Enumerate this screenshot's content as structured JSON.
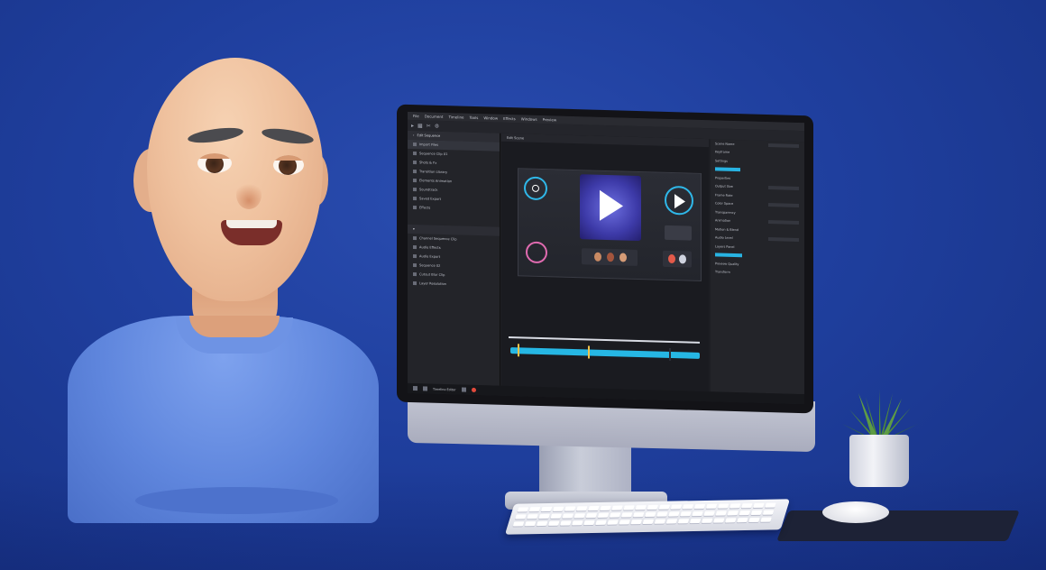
{
  "scene": {
    "background": "#1f3f9e",
    "shirt_color": "#6a8fe4",
    "skin_color": "#efc19e"
  },
  "monitor_ui": {
    "accent": "#28b3e2",
    "menu": [
      "File",
      "Document",
      "Timeline",
      "Tools",
      "Window",
      "Effects",
      "Windows",
      "Preview"
    ],
    "center_tab": "Edit Scene",
    "left_panel_title": "Edit Sequence",
    "left_rows": [
      "Import Files",
      "Sequence Clip 01",
      "Shots & Fx",
      "Transition Library",
      "Elements Animation",
      "Soundtrack",
      "Saved Export",
      "Effects"
    ],
    "left_rows_lower": [
      "Channel Sequence Clip",
      "Audio Effects",
      "Audio Export",
      "Sequence 02",
      "Cutout Blur Clip",
      "Layer Resolution"
    ],
    "right_rows": [
      "Scene Name",
      "Keyframe",
      "Settings",
      "Properties",
      "Output Size",
      "Frame Rate",
      "Color Space",
      "Transparency",
      "Animation",
      "Motion & Blend",
      "Audio Level",
      "Layers Panel",
      "Preview Quality",
      "Transform"
    ],
    "taskbar_label": "Timeline Editor"
  }
}
